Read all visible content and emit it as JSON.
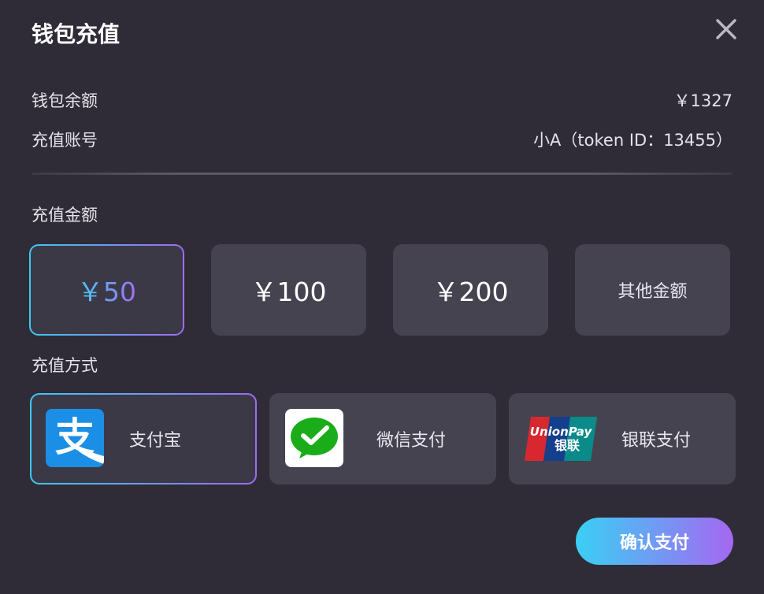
{
  "dialog": {
    "title": "钱包充值",
    "close_icon": "close-icon"
  },
  "wallet": {
    "balance_label": "钱包余额",
    "balance_value": "￥1327",
    "account_label": "充值账号",
    "account_value": "小A（token ID：13455）"
  },
  "amounts": {
    "label": "充值金额",
    "options": [
      "￥50",
      "￥100",
      "￥200",
      "其他金额"
    ],
    "selected_index": 0
  },
  "methods": {
    "label": "充值方式",
    "options": [
      {
        "label": "支付宝",
        "icon": "alipay-icon",
        "selected": true
      },
      {
        "label": "微信支付",
        "icon": "wechat-pay-icon",
        "selected": false
      },
      {
        "label": "银联支付",
        "icon": "unionpay-icon",
        "selected": false
      }
    ]
  },
  "confirm_label": "确认支付",
  "colors": {
    "background": "#2f2c37",
    "card": "#464350",
    "accent_start": "#3ad0f4",
    "accent_end": "#a567f2",
    "alipay": "#1a8fe5",
    "wechat": "#1aad19"
  },
  "logos": {
    "alipay_glyph": "支",
    "unionpay_brand": "UnionPay",
    "unionpay_cn": "银联"
  }
}
